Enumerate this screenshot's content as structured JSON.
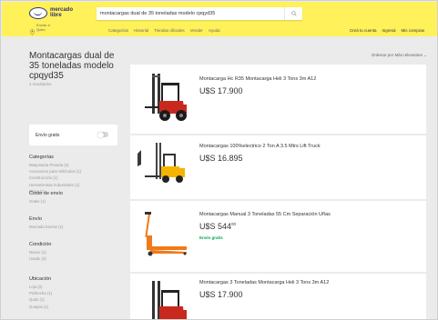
{
  "header": {
    "logo_line1": "mercado",
    "logo_line2": "libre",
    "search_value": "montacargas dual de 35 toneladas modelo cpqyd35",
    "location_line1": "Enviar a",
    "location_line2": "Quito",
    "nav": [
      "Categorías",
      "Historial",
      "Tiendas oficiales",
      "Vender",
      "Ayuda"
    ],
    "nav_right": [
      "Creá tu cuenta",
      "Ingresá",
      "Mis compras"
    ]
  },
  "sidebar": {
    "title": "Montacargas dual de 35 toneladas modelo cpqyd35",
    "results_count": "4 resultados",
    "free_shipping_label": "Envío gratis",
    "free_shipping_on": false,
    "facets": [
      {
        "title": "Categorías",
        "items": [
          "Maquinaria Pesada (2)",
          "Accesorios para Vehículos (1)",
          "Construcción (1)",
          "Herramientas Industriales (1)",
          "Otros (1)"
        ]
      },
      {
        "title": "Costo de envío",
        "items": [
          "Gratis (1)"
        ]
      },
      {
        "title": "Envío",
        "items": [
          "Mercado Envíos (1)"
        ]
      },
      {
        "title": "Condición",
        "items": [
          "Nuevo (1)",
          "Usado (3)"
        ]
      },
      {
        "title": "Ubicación",
        "items": [
          "Loja (2)",
          "Pichincha (1)",
          "Quito (1)",
          "Guayas (1)"
        ]
      }
    ]
  },
  "sort": {
    "label": "Ordenar por",
    "value": "Más relevantes"
  },
  "results": [
    {
      "title": "Montacarga Hc R35 Montacarga Heli 3 Tons 3m A12",
      "price": "U$S 17.900",
      "cents": "",
      "free_shipping": ""
    },
    {
      "title": "Montacargas 100%electrico 2 Ton A 3.5 Mtrs Lift Truck",
      "price": "U$S 16.895",
      "cents": "",
      "free_shipping": ""
    },
    {
      "title": "Montacargas Manual 3 Toneladas 55 Cm Separación Uñas",
      "price": "U$S 544",
      "cents": "00",
      "free_shipping": "Envío gratis"
    },
    {
      "title": "Montacargas 3 Toneladas Montacarga Heli 3 Tons 3m A12",
      "price": "U$S 17.900",
      "cents": "",
      "free_shipping": ""
    }
  ],
  "colors": {
    "brand_yellow": "#fff159",
    "brand_blue": "#2d3277",
    "free_green": "#00a650",
    "forklift_red": "#c8281e",
    "forklift_orange": "#f07a1a"
  }
}
